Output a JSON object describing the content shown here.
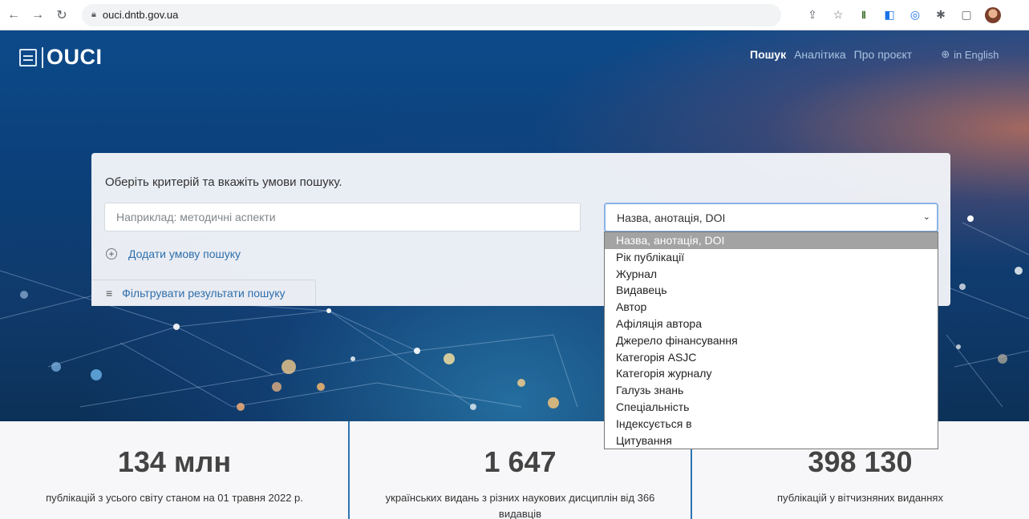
{
  "browser": {
    "url": "ouci.dntb.gov.ua",
    "icons": [
      "back-icon",
      "forward-icon",
      "reload-icon",
      "lock-icon",
      "share-icon",
      "star-icon",
      "extension-icon",
      "translate-icon",
      "extension-icon",
      "puzzle-icon",
      "sidebar-icon",
      "profile-avatar"
    ]
  },
  "header": {
    "logo_text": "OUCI",
    "nav": [
      "Пошук",
      "Аналітика",
      "Про проєкт"
    ],
    "active_nav": "Пошук",
    "language": "in English"
  },
  "search": {
    "title": "Оберіть критерій та вкажіть умови пошуку.",
    "placeholder": "Наприклад: методичні аспекти",
    "selected_criterion": "Назва, анотація, DOI",
    "add_condition": "Додати умову пошуку",
    "filter_results": "Фільтрувати результати пошуку",
    "options": [
      "Назва, анотація, DOI",
      "Рік публікації",
      "Журнал",
      "Видавець",
      "Автор",
      "Афіляція автора",
      "Джерело фінансування",
      "Категорія ASJC",
      "Категорія журналу",
      "Галузь знань",
      "Спеціальність",
      "Індексується в",
      "Цитування"
    ]
  },
  "stats": [
    {
      "number": "134 млн",
      "label": "публікацій з усього світу станом на 01 травня 2022 р."
    },
    {
      "number": "1 647",
      "label": "українських видань з різних наукових дисциплін від 366 видавців"
    },
    {
      "number": "398 130",
      "label": "публікацій у вітчизняних виданнях"
    }
  ],
  "colors": {
    "accent": "#2a74b5",
    "link": "#2f6fab",
    "hero": "#0d4a8a"
  }
}
